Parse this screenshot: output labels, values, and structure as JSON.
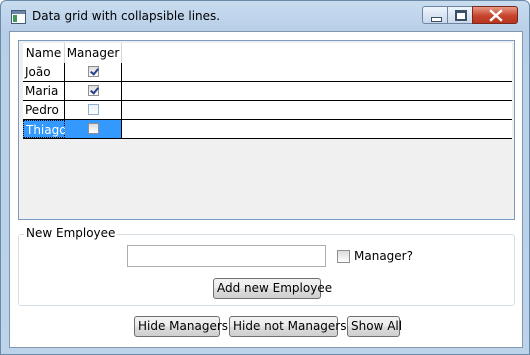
{
  "window": {
    "title": "Data grid with collapsible lines."
  },
  "grid": {
    "columns": [
      "Name",
      "Manager"
    ],
    "rows": [
      {
        "name": "João",
        "manager": true
      },
      {
        "name": "Maria",
        "manager": true
      },
      {
        "name": "Pedro",
        "manager": false
      },
      {
        "name": "Thiago",
        "manager": false
      }
    ],
    "selected_row": "Thiago"
  },
  "new_employee": {
    "legend": "New Employee",
    "name_value": "",
    "manager_label": "Manager?",
    "manager_checked": false,
    "add_button": "Add new Employee"
  },
  "actions": {
    "hide_managers": "Hide Managers",
    "hide_not_managers": "Hide not Managers",
    "show_all": "Show All"
  }
}
